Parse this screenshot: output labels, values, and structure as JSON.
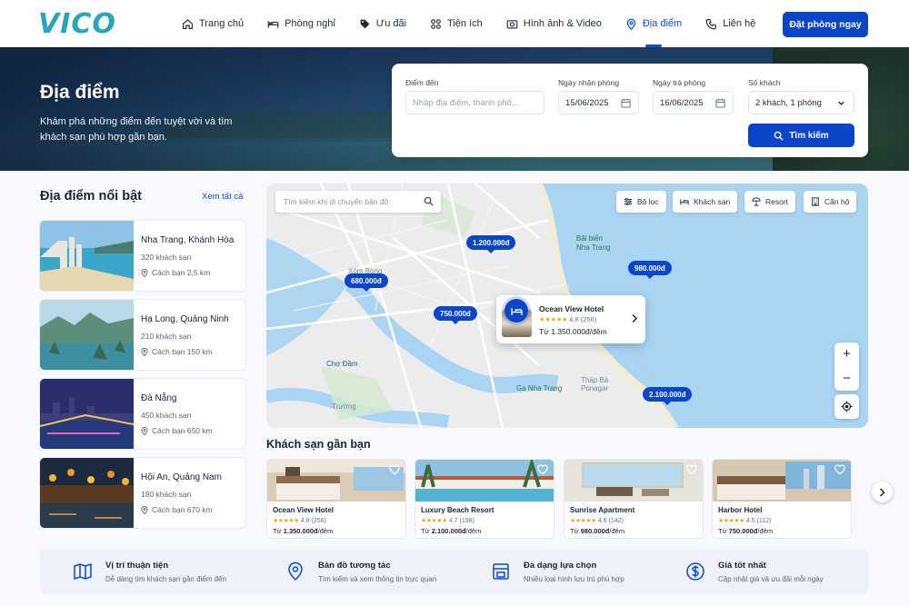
{
  "brand": {
    "logo": "VICO",
    "accent": "#0b46c9",
    "logo_color": "#2aa4b8"
  },
  "nav": {
    "items": [
      {
        "label": "Trang chủ",
        "icon": "home-icon"
      },
      {
        "label": "Phòng nghỉ",
        "icon": "bed-icon"
      },
      {
        "label": "Ưu đãi",
        "icon": "tag-icon"
      },
      {
        "label": "Tiện ích",
        "icon": "grid-icon"
      },
      {
        "label": "Hình ảnh & Video",
        "icon": "camera-icon"
      },
      {
        "label": "Địa điểm",
        "icon": "location-pin-icon",
        "active": true
      },
      {
        "label": "Liên hệ",
        "icon": "phone-icon"
      }
    ],
    "cta": "Đặt phòng ngay"
  },
  "hero": {
    "title": "Địa điểm",
    "subtitle": "Khám phá những điểm đến tuyệt vời và tìm khách sạn phù hợp gần bạn."
  },
  "search": {
    "destination_label": "Điểm đến",
    "destination_placeholder": "Nhập địa điểm, thành phố...",
    "checkin_label": "Ngày nhận phòng",
    "checkin_value": "15/06/2025",
    "checkout_label": "Ngày trả phòng",
    "checkout_value": "16/06/2025",
    "guests_label": "Số khách",
    "guests_value": "2 khách, 1 phòng",
    "button": "Tìm kiếm"
  },
  "featured": {
    "title": "Địa điểm nổi bật",
    "see_all": "Xem tất cả",
    "items": [
      {
        "name": "Nha Trang, Khánh Hòa",
        "count": "320 khách sạn",
        "distance": "Cách bạn 2,5 km"
      },
      {
        "name": "Hạ Long, Quảng Ninh",
        "count": "210 khách sạn",
        "distance": "Cách bạn 150 km"
      },
      {
        "name": "Đà Nẵng",
        "count": "450 khách sạn",
        "distance": "Cách bạn 650 km"
      },
      {
        "name": "Hội An, Quảng Nam",
        "count": "180 khách sạn",
        "distance": "Cách bạn 670 km"
      }
    ]
  },
  "map": {
    "search_placeholder": "Tìm kiếm khi di chuyển bản đồ",
    "filters": [
      "Bộ lọc",
      "Khách sạn",
      "Resort",
      "Căn hộ"
    ],
    "prices": [
      "1.200.000đ",
      "980.000đ",
      "680.000đ",
      "750.000đ",
      "2.100.000đ"
    ],
    "labels": {
      "beach": "Bãi biển\nNha Trang",
      "market": "Chợ Đầm",
      "river": "Ga Nha Trang",
      "tower": "Tháp Bà\nPonagar",
      "truong": "Trường",
      "xom": "Xóm Bóng"
    },
    "popup": {
      "name": "Ocean View Hotel",
      "stars": "★★★★★",
      "rating": "4.8 (256)",
      "price": "Từ 1.350.000đ/đêm"
    },
    "zoom_in": "+",
    "zoom_out": "−"
  },
  "nearby": {
    "title": "Khách sạn gần bạn",
    "hotels": [
      {
        "name": "Ocean View Hotel",
        "stars": "★★★★★",
        "rating": "4.8 (256)",
        "price_prefix": "Từ ",
        "price": "1.350.000đ",
        "price_suffix": "/đêm"
      },
      {
        "name": "Luxury Beach Resort",
        "stars": "★★★★★",
        "rating": "4.7 (198)",
        "price_prefix": "Từ ",
        "price": "2.100.000đ",
        "price_suffix": "/đêm"
      },
      {
        "name": "Sunrise Apartment",
        "stars": "★★★★★",
        "rating": "4.6 (142)",
        "price_prefix": "Từ ",
        "price": "980.000đ",
        "price_suffix": "/đêm"
      },
      {
        "name": "Harbor Hotel",
        "stars": "★★★★★",
        "rating": "4.5 (112)",
        "price_prefix": "Từ ",
        "price": "750.000đ",
        "price_suffix": "/đêm"
      }
    ]
  },
  "features": [
    {
      "title": "Vị trí thuận tiện",
      "desc": "Dễ dàng tìm khách sạn gần điểm đến"
    },
    {
      "title": "Bản đồ tương tác",
      "desc": "Tìm kiếm và xem thông tin trực quan"
    },
    {
      "title": "Đa dạng lựa chọn",
      "desc": "Nhiều loại hình lưu trú phù hợp"
    },
    {
      "title": "Giá tốt nhất",
      "desc": "Cập nhật giá và ưu đãi mỗi ngày"
    }
  ]
}
